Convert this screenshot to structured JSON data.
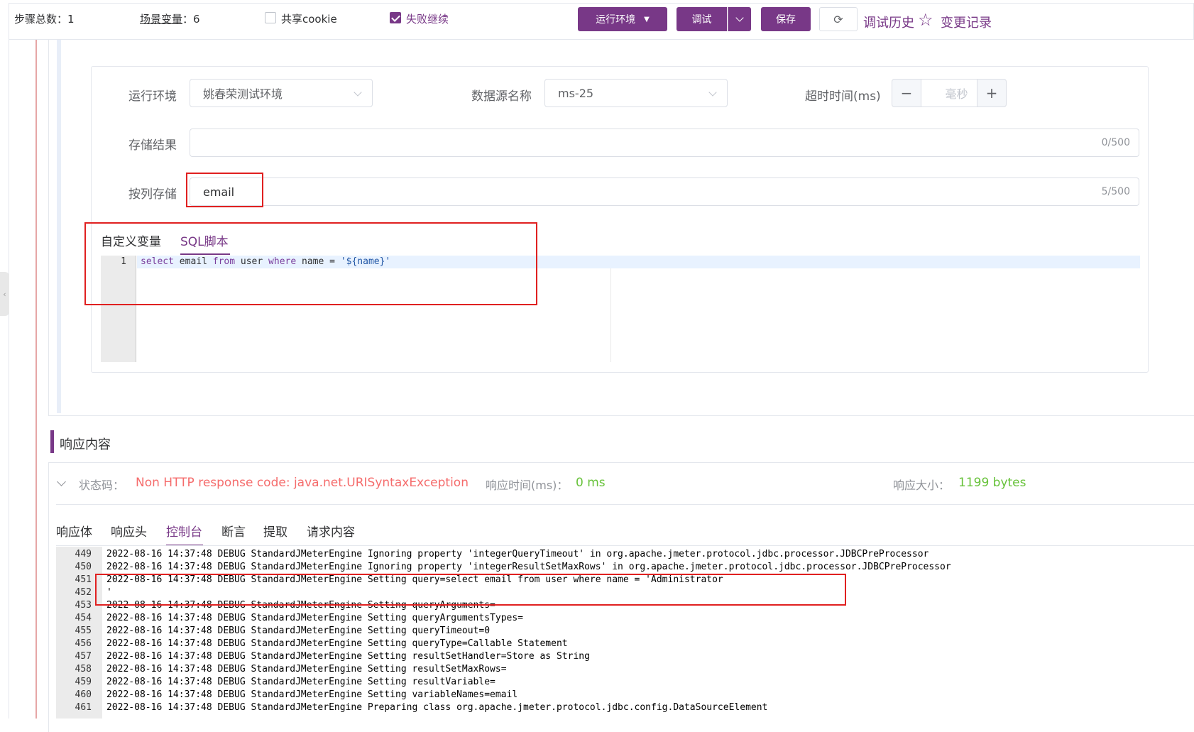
{
  "toolbar": {
    "steps_label": "步骤总数：",
    "steps_value": "1",
    "scene_vars_label": "场景变量",
    "scene_vars_sep": "：",
    "scene_vars_value": "6",
    "share_cookie_label": "共享cookie",
    "share_cookie_checked": false,
    "fail_continue_label": "失败继续",
    "fail_continue_checked": true,
    "run_env_label": "运行环境",
    "debug_label": "调试",
    "save_label": "保存",
    "refresh_icon": "refresh-icon",
    "debug_history_label": "调试历史",
    "change_log_label": "变更记录",
    "star_icon": "star-icon"
  },
  "form": {
    "run_env_label": "运行环境",
    "run_env_value": "姚春荣测试环境",
    "datasource_label": "数据源名称",
    "datasource_value": "ms-25",
    "timeout_label": "超时时间(ms)",
    "timeout_placeholder": "毫秒",
    "timeout_minus": "−",
    "timeout_plus": "+",
    "store_result_label": "存储结果",
    "store_result_value": "",
    "store_result_count": "0/500",
    "col_store_label": "按列存储",
    "col_store_value": "email",
    "col_store_count": "5/500"
  },
  "script_tabs": {
    "custom_vars": "自定义变量",
    "sql_script": "SQL脚本"
  },
  "editor": {
    "line_no": "1",
    "kw_select": "select",
    "t_email": " email ",
    "kw_from": "from",
    "t_user": " user ",
    "kw_where": "where",
    "t_name": " name = ",
    "str_value": "'${name}'"
  },
  "response": {
    "title": "响应内容",
    "status_label": "状态码：",
    "status_value": "Non HTTP response code: java.net.URISyntaxException",
    "time_label": "响应时间(ms)：",
    "time_value": "0 ms",
    "size_label": "响应大小：",
    "size_value": "1199 bytes",
    "tabs": [
      "响应体",
      "响应头",
      "控制台",
      "断言",
      "提取",
      "请求内容"
    ],
    "active_tab": "控制台"
  },
  "colors": {
    "brand": "#783887",
    "error": "#f56c6c",
    "success": "#67c23a",
    "highlight_box": "#e02020"
  },
  "console": [
    {
      "no": "449",
      "text": "2022-08-16 14:37:48 DEBUG StandardJMeterEngine Ignoring property 'integerQueryTimeout' in org.apache.jmeter.protocol.jdbc.processor.JDBCPreProcessor"
    },
    {
      "no": "450",
      "text": "2022-08-16 14:37:48 DEBUG StandardJMeterEngine Ignoring property 'integerResultSetMaxRows' in org.apache.jmeter.protocol.jdbc.processor.JDBCPreProcessor"
    },
    {
      "no": "451",
      "text": "2022-08-16 14:37:48 DEBUG StandardJMeterEngine Setting query=select email from user where name = 'Administrator"
    },
    {
      "no": "452",
      "text": "'"
    },
    {
      "no": "453",
      "text": "2022-08-16 14:37:48 DEBUG StandardJMeterEngine Setting queryArguments="
    },
    {
      "no": "454",
      "text": "2022-08-16 14:37:48 DEBUG StandardJMeterEngine Setting queryArgumentsTypes="
    },
    {
      "no": "455",
      "text": "2022-08-16 14:37:48 DEBUG StandardJMeterEngine Setting queryTimeout=0"
    },
    {
      "no": "456",
      "text": "2022-08-16 14:37:48 DEBUG StandardJMeterEngine Setting queryType=Callable Statement"
    },
    {
      "no": "457",
      "text": "2022-08-16 14:37:48 DEBUG StandardJMeterEngine Setting resultSetHandler=Store as String"
    },
    {
      "no": "458",
      "text": "2022-08-16 14:37:48 DEBUG StandardJMeterEngine Setting resultSetMaxRows="
    },
    {
      "no": "459",
      "text": "2022-08-16 14:37:48 DEBUG StandardJMeterEngine Setting resultVariable="
    },
    {
      "no": "460",
      "text": "2022-08-16 14:37:48 DEBUG StandardJMeterEngine Setting variableNames=email"
    },
    {
      "no": "461",
      "text": "2022-08-16 14:37:48 DEBUG StandardJMeterEngine Preparing class org.apache.jmeter.protocol.jdbc.config.DataSourceElement"
    }
  ]
}
